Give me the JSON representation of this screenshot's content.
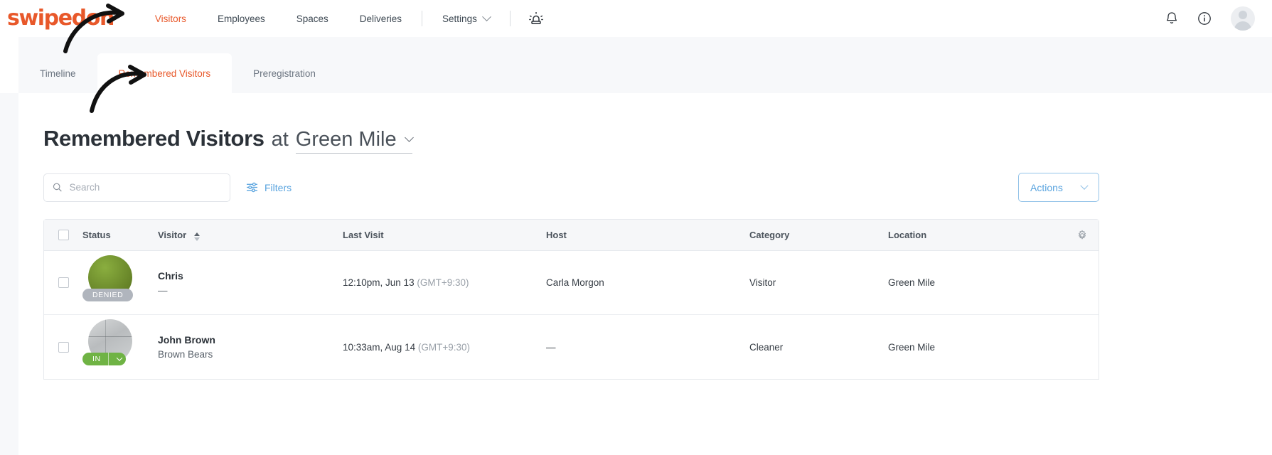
{
  "brand": {
    "logo_text": "swipedon",
    "accent": "#E8582A"
  },
  "topnav": {
    "items": [
      {
        "label": "Visitors",
        "active": true
      },
      {
        "label": "Employees",
        "active": false
      },
      {
        "label": "Spaces",
        "active": false
      },
      {
        "label": "Deliveries",
        "active": false
      },
      {
        "label": "Settings",
        "active": false,
        "has_chevron": true
      }
    ],
    "emergency_icon": "siren-icon",
    "notifications_icon": "bell-icon",
    "help_icon": "info-icon",
    "avatar": "user-avatar"
  },
  "tabs": [
    {
      "label": "Timeline",
      "active": false
    },
    {
      "label": "Remembered Visitors",
      "active": true
    },
    {
      "label": "Preregistration",
      "active": false
    }
  ],
  "page": {
    "title_strong": "Remembered Visitors",
    "title_light": "at",
    "location_value": "Green Mile"
  },
  "toolbar": {
    "search_placeholder": "Search",
    "search_value": "",
    "filters_label": "Filters",
    "actions_label": "Actions"
  },
  "table": {
    "columns": [
      {
        "key": "status",
        "label": "Status",
        "sortable": false
      },
      {
        "key": "visitor",
        "label": "Visitor",
        "sortable": true
      },
      {
        "key": "last_visit",
        "label": "Last Visit",
        "sortable": false
      },
      {
        "key": "host",
        "label": "Host",
        "sortable": false
      },
      {
        "key": "category",
        "label": "Category",
        "sortable": false
      },
      {
        "key": "location",
        "label": "Location",
        "sortable": false
      }
    ],
    "settings_icon": "gear-icon",
    "rows": [
      {
        "selected": false,
        "avatar_style": "green",
        "status_badge": "DENIED",
        "status_type": "denied",
        "visitor_name": "Chris",
        "visitor_sub": "—",
        "last_visit_time": "12:10pm, Jun 13",
        "last_visit_tz": "(GMT+9:30)",
        "host": "Carla Morgon",
        "category": "Visitor",
        "location": "Green Mile"
      },
      {
        "selected": false,
        "avatar_style": "gray",
        "status_badge": "IN",
        "status_type": "in",
        "visitor_name": "John Brown",
        "visitor_sub": "Brown Bears",
        "last_visit_time": "10:33am, Aug 14",
        "last_visit_tz": "(GMT+9:30)",
        "host": "—",
        "category": "Cleaner",
        "location": "Green Mile"
      }
    ]
  }
}
